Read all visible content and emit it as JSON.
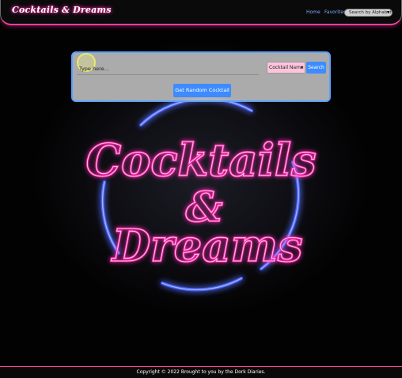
{
  "navbar": {
    "brand": "Cocktails & Dreams",
    "links": [
      "Home",
      "Favorites"
    ],
    "filter_select": "Search by Alphabet"
  },
  "search": {
    "placeholder": "Type here...",
    "type_select": "Cocktail Name",
    "button_label": "Search",
    "random_label": "Get Random Cocktail"
  },
  "hero": {
    "line1": "Cocktails",
    "line2": "&",
    "line3": "Dreams"
  },
  "footer": {
    "text": "Copyright © 2022 Brought to you by the Dork Diaries."
  },
  "colors": {
    "neon_pink": "#ff2fb0",
    "neon_blue": "#2d4dff",
    "button_blue": "#3d8bff"
  }
}
